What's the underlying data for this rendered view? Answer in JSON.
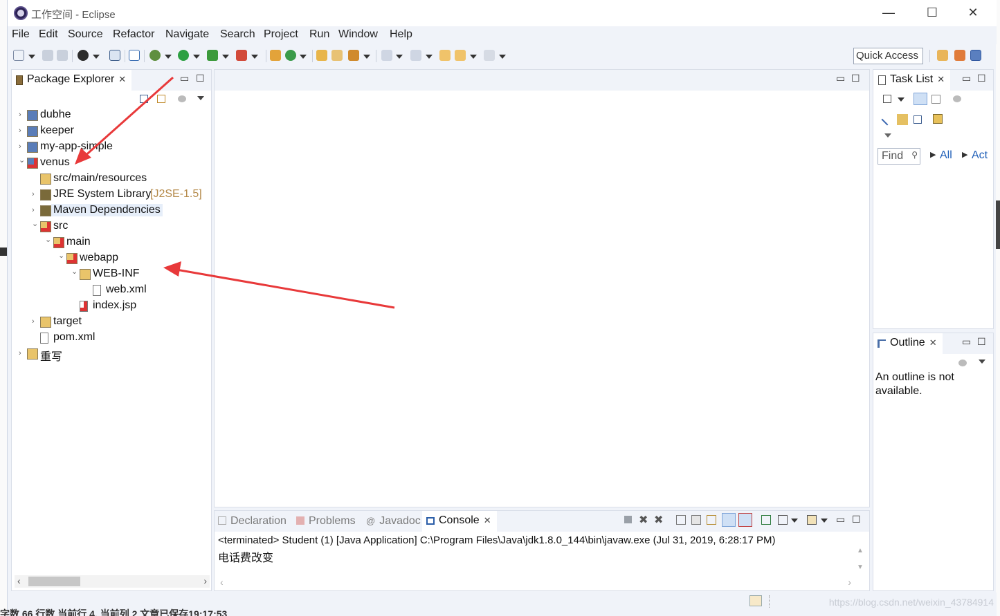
{
  "window": {
    "title": "工作空间 - Eclipse",
    "minimize": "—",
    "maximize": "☐",
    "close": "✕"
  },
  "menu": [
    "File",
    "Edit",
    "Source",
    "Refactor",
    "Navigate",
    "Search",
    "Project",
    "Run",
    "Window",
    "Help"
  ],
  "toolbar": {
    "quick_access": "Quick Access"
  },
  "package_explorer": {
    "tab_label": "Package Explorer",
    "tree": [
      {
        "label": "dubhe",
        "level": 0,
        "expanded": false,
        "icon": "maven-project-icon"
      },
      {
        "label": "keeper",
        "level": 0,
        "expanded": false,
        "icon": "maven-project-icon"
      },
      {
        "label": "my-app-simple",
        "level": 0,
        "expanded": false,
        "icon": "maven-project-icon"
      },
      {
        "label": "venus",
        "level": 0,
        "expanded": true,
        "icon": "maven-project-error-icon"
      },
      {
        "label": "src/main/resources",
        "level": 1,
        "expanded": null,
        "icon": "source-folder-icon"
      },
      {
        "label": "JRE System Library",
        "decoration": "[J2SE-1.5]",
        "level": 1,
        "expanded": false,
        "icon": "library-icon"
      },
      {
        "label": "Maven Dependencies",
        "level": 1,
        "expanded": false,
        "icon": "library-icon",
        "selected": true
      },
      {
        "label": "src",
        "level": 1,
        "expanded": true,
        "icon": "folder-error-icon"
      },
      {
        "label": "main",
        "level": 2,
        "expanded": true,
        "icon": "folder-error-icon"
      },
      {
        "label": "webapp",
        "level": 3,
        "expanded": true,
        "icon": "folder-error-icon"
      },
      {
        "label": "WEB-INF",
        "level": 4,
        "expanded": true,
        "icon": "folder-icon"
      },
      {
        "label": "web.xml",
        "level": 5,
        "expanded": null,
        "icon": "xml-file-icon"
      },
      {
        "label": "index.jsp",
        "level": 4,
        "expanded": null,
        "icon": "jsp-file-error-icon"
      },
      {
        "label": "target",
        "level": 1,
        "expanded": false,
        "icon": "folder-icon"
      },
      {
        "label": "pom.xml",
        "level": 1,
        "expanded": null,
        "icon": "pom-file-icon"
      },
      {
        "label": "重写",
        "level": 0,
        "expanded": false,
        "icon": "java-project-icon"
      }
    ]
  },
  "task_list": {
    "tab_label": "Task List",
    "find_placeholder": "Find",
    "filter_all": "All",
    "filter_act": "Act"
  },
  "outline": {
    "tab_label": "Outline",
    "message": "An outline is not available."
  },
  "console": {
    "tabs": [
      "Declaration",
      "Problems",
      "Javadoc",
      "Console"
    ],
    "active_tab": "Console",
    "header": "<terminated> Student (1) [Java Application] C:\\Program Files\\Java\\jdk1.8.0_144\\bin\\javaw.exe (Jul 31, 2019, 6:28:17 PM)",
    "output": "电话费改变"
  },
  "status": {
    "watermark": "https://blog.csdn.net/weixin_43784914",
    "bottom_text": "字数 66 行数 当前行 4, 当前列 2 文章已保存19:17:53"
  },
  "colors": {
    "accent": "#e8393a",
    "selection": "#e6eef9",
    "chrome": "#f0f3f9"
  }
}
